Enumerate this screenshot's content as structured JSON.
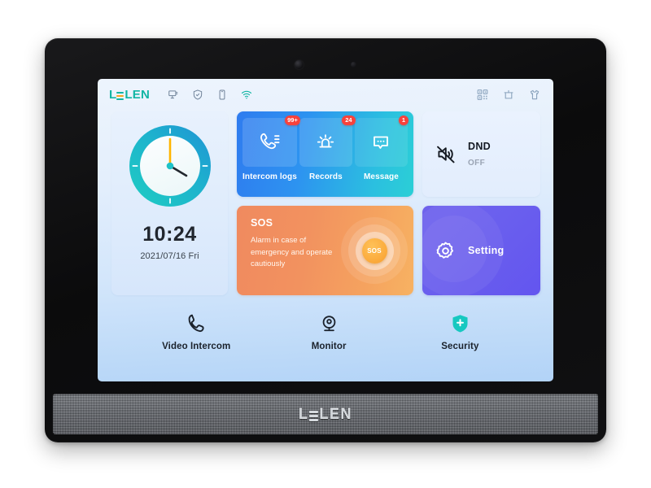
{
  "device": {
    "brand": "LEELEN",
    "grille_brand": "LEELEN"
  },
  "statusbar": {
    "logo_left": "L",
    "logo_right": "LEN",
    "icons_left": [
      {
        "name": "screen-monitor-icon"
      },
      {
        "name": "shield-check-icon"
      },
      {
        "name": "mobile-phone-icon"
      },
      {
        "name": "wifi-icon"
      }
    ],
    "icons_right": [
      {
        "name": "qr-code-icon"
      },
      {
        "name": "calendar-icon"
      },
      {
        "name": "shirt-icon"
      }
    ],
    "wifi_color": "#12b5a4"
  },
  "clock": {
    "time": "10:24",
    "date": "2021/07/16 Fri",
    "ring_color_start": "#1f9fd0",
    "ring_color_end": "#1fc9c3",
    "minute_hand_color": "#ffb500",
    "hour_hand_color": "#23282f"
  },
  "intercom_card": {
    "tiles": [
      {
        "label": "Intercom logs",
        "badge": "99+",
        "icon": "phone-list-icon"
      },
      {
        "label": "Records",
        "badge": "24",
        "icon": "alarm-light-icon"
      },
      {
        "label": "Message",
        "badge": "1",
        "icon": "message-bubble-icon"
      }
    ],
    "gradient_start": "#2f7cef",
    "gradient_end": "#2bcfd6",
    "badge_color": "#f8423c"
  },
  "dnd_card": {
    "title": "DND",
    "state": "OFF",
    "icon": "mute-speaker-icon"
  },
  "sos_card": {
    "title": "SOS",
    "description": "Alarm in case of emergency and operate cautiously",
    "button_label": "SOS",
    "gradient_start": "#f08a5f",
    "gradient_end": "#f7b262"
  },
  "setting_card": {
    "label": "Setting",
    "icon": "gear-icon",
    "gradient_start": "#6f63ec",
    "gradient_end": "#6355ef"
  },
  "bottom_nav": [
    {
      "label": "Video Intercom",
      "icon": "phone-handset-icon"
    },
    {
      "label": "Monitor",
      "icon": "webcam-icon"
    },
    {
      "label": "Security",
      "icon": "shield-plus-icon"
    }
  ]
}
